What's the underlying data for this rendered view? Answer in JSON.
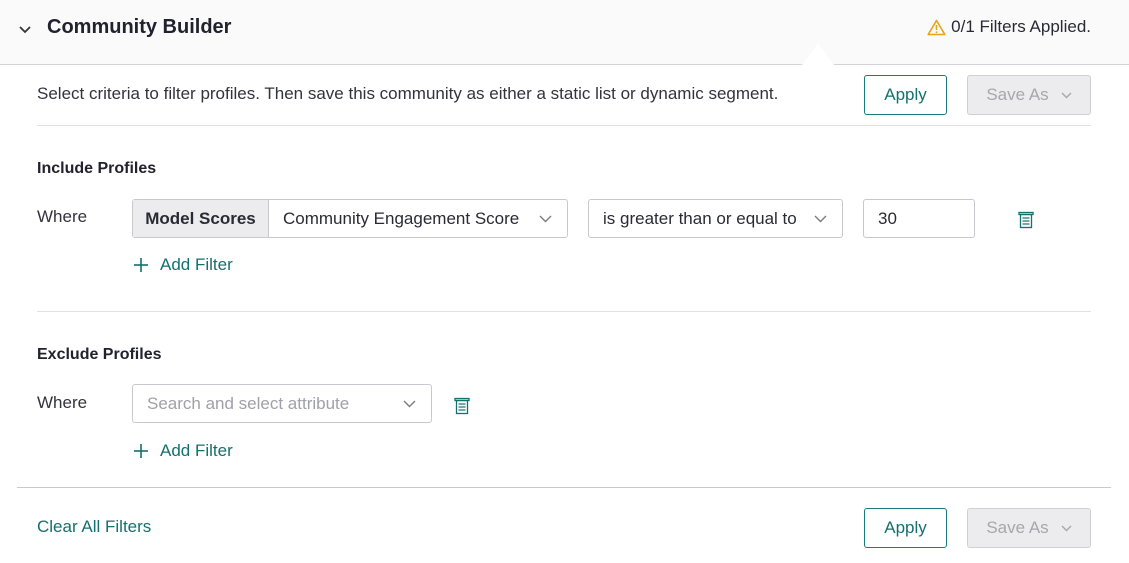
{
  "header": {
    "title": "Community Builder",
    "status": "0/1 Filters Applied.",
    "icons": {
      "collapse": "chevron-down-icon",
      "status": "warning-triangle-icon"
    }
  },
  "description": "Select criteria to filter profiles. Then save this community as either a static list or dynamic segment.",
  "actions": {
    "apply_label": "Apply",
    "save_as_label": "Save As"
  },
  "include": {
    "title": "Include Profiles",
    "where_label": "Where",
    "category": "Model Scores",
    "attribute": "Community Engagement Score",
    "operator": "is greater than or equal to",
    "value": "30",
    "add_filter_label": "Add Filter"
  },
  "exclude": {
    "title": "Exclude Profiles",
    "where_label": "Where",
    "attribute_placeholder": "Search and select attribute",
    "add_filter_label": "Add Filter"
  },
  "footer": {
    "clear_all_label": "Clear All Filters",
    "apply_label": "Apply",
    "save_as_label": "Save As"
  },
  "colors": {
    "accent": "#14706e",
    "warning": "#e8a317",
    "disabled_bg": "#ececee"
  }
}
